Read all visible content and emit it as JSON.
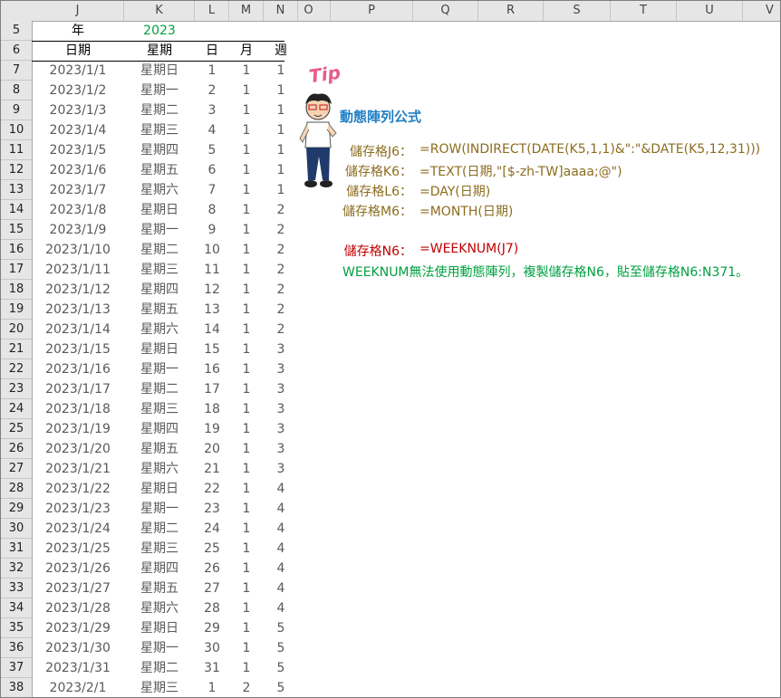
{
  "columns": [
    "J",
    "K",
    "L",
    "M",
    "N",
    "O",
    "P",
    "Q",
    "R",
    "S",
    "T",
    "U",
    "V"
  ],
  "year_row": {
    "row": "5",
    "label": "年",
    "value": "2023"
  },
  "header_row": {
    "row": "6",
    "headers": [
      "日期",
      "星期",
      "日",
      "月",
      "週"
    ]
  },
  "rows": [
    {
      "n": "7",
      "date": "2023/1/1",
      "wd": "星期日",
      "d": "1",
      "m": "1",
      "w": "1"
    },
    {
      "n": "8",
      "date": "2023/1/2",
      "wd": "星期一",
      "d": "2",
      "m": "1",
      "w": "1"
    },
    {
      "n": "9",
      "date": "2023/1/3",
      "wd": "星期二",
      "d": "3",
      "m": "1",
      "w": "1"
    },
    {
      "n": "10",
      "date": "2023/1/4",
      "wd": "星期三",
      "d": "4",
      "m": "1",
      "w": "1"
    },
    {
      "n": "11",
      "date": "2023/1/5",
      "wd": "星期四",
      "d": "5",
      "m": "1",
      "w": "1"
    },
    {
      "n": "12",
      "date": "2023/1/6",
      "wd": "星期五",
      "d": "6",
      "m": "1",
      "w": "1"
    },
    {
      "n": "13",
      "date": "2023/1/7",
      "wd": "星期六",
      "d": "7",
      "m": "1",
      "w": "1"
    },
    {
      "n": "14",
      "date": "2023/1/8",
      "wd": "星期日",
      "d": "8",
      "m": "1",
      "w": "2"
    },
    {
      "n": "15",
      "date": "2023/1/9",
      "wd": "星期一",
      "d": "9",
      "m": "1",
      "w": "2"
    },
    {
      "n": "16",
      "date": "2023/1/10",
      "wd": "星期二",
      "d": "10",
      "m": "1",
      "w": "2"
    },
    {
      "n": "17",
      "date": "2023/1/11",
      "wd": "星期三",
      "d": "11",
      "m": "1",
      "w": "2"
    },
    {
      "n": "18",
      "date": "2023/1/12",
      "wd": "星期四",
      "d": "12",
      "m": "1",
      "w": "2"
    },
    {
      "n": "19",
      "date": "2023/1/13",
      "wd": "星期五",
      "d": "13",
      "m": "1",
      "w": "2"
    },
    {
      "n": "20",
      "date": "2023/1/14",
      "wd": "星期六",
      "d": "14",
      "m": "1",
      "w": "2"
    },
    {
      "n": "21",
      "date": "2023/1/15",
      "wd": "星期日",
      "d": "15",
      "m": "1",
      "w": "3"
    },
    {
      "n": "22",
      "date": "2023/1/16",
      "wd": "星期一",
      "d": "16",
      "m": "1",
      "w": "3"
    },
    {
      "n": "23",
      "date": "2023/1/17",
      "wd": "星期二",
      "d": "17",
      "m": "1",
      "w": "3"
    },
    {
      "n": "24",
      "date": "2023/1/18",
      "wd": "星期三",
      "d": "18",
      "m": "1",
      "w": "3"
    },
    {
      "n": "25",
      "date": "2023/1/19",
      "wd": "星期四",
      "d": "19",
      "m": "1",
      "w": "3"
    },
    {
      "n": "26",
      "date": "2023/1/20",
      "wd": "星期五",
      "d": "20",
      "m": "1",
      "w": "3"
    },
    {
      "n": "27",
      "date": "2023/1/21",
      "wd": "星期六",
      "d": "21",
      "m": "1",
      "w": "3"
    },
    {
      "n": "28",
      "date": "2023/1/22",
      "wd": "星期日",
      "d": "22",
      "m": "1",
      "w": "4"
    },
    {
      "n": "29",
      "date": "2023/1/23",
      "wd": "星期一",
      "d": "23",
      "m": "1",
      "w": "4"
    },
    {
      "n": "30",
      "date": "2023/1/24",
      "wd": "星期二",
      "d": "24",
      "m": "1",
      "w": "4"
    },
    {
      "n": "31",
      "date": "2023/1/25",
      "wd": "星期三",
      "d": "25",
      "m": "1",
      "w": "4"
    },
    {
      "n": "32",
      "date": "2023/1/26",
      "wd": "星期四",
      "d": "26",
      "m": "1",
      "w": "4"
    },
    {
      "n": "33",
      "date": "2023/1/27",
      "wd": "星期五",
      "d": "27",
      "m": "1",
      "w": "4"
    },
    {
      "n": "34",
      "date": "2023/1/28",
      "wd": "星期六",
      "d": "28",
      "m": "1",
      "w": "4"
    },
    {
      "n": "35",
      "date": "2023/1/29",
      "wd": "星期日",
      "d": "29",
      "m": "1",
      "w": "5"
    },
    {
      "n": "36",
      "date": "2023/1/30",
      "wd": "星期一",
      "d": "30",
      "m": "1",
      "w": "5"
    },
    {
      "n": "37",
      "date": "2023/1/31",
      "wd": "星期二",
      "d": "31",
      "m": "1",
      "w": "5"
    },
    {
      "n": "38",
      "date": "2023/2/1",
      "wd": "星期三",
      "d": "1",
      "m": "2",
      "w": "5"
    }
  ],
  "tip": {
    "badge": "Tip",
    "title": "動態陣列公式",
    "formulas": [
      {
        "label": "儲存格J6：",
        "formula": "=ROW(INDIRECT(DATE(K5,1,1)&\":\"&DATE(K5,12,31)))"
      },
      {
        "label": "儲存格K6：",
        "formula": "=TEXT(日期,\"[$-zh-TW]aaaa;@\")"
      },
      {
        "label": "儲存格L6：",
        "formula": "=DAY(日期)"
      },
      {
        "label": "儲存格M6：",
        "formula": "=MONTH(日期)"
      }
    ],
    "red_formula": {
      "label": "儲存格N6：",
      "formula": "=WEEKNUM(J7)"
    },
    "note": "WEEKNUM無法使用動態陣列，複製儲存格N6，貼至儲存格N6:N371。"
  },
  "colors": {
    "formula": "#8c6d1f",
    "title": "#1f7fc4",
    "red": "#c00000",
    "green": "#00a040",
    "tip": "#e85c8a"
  }
}
